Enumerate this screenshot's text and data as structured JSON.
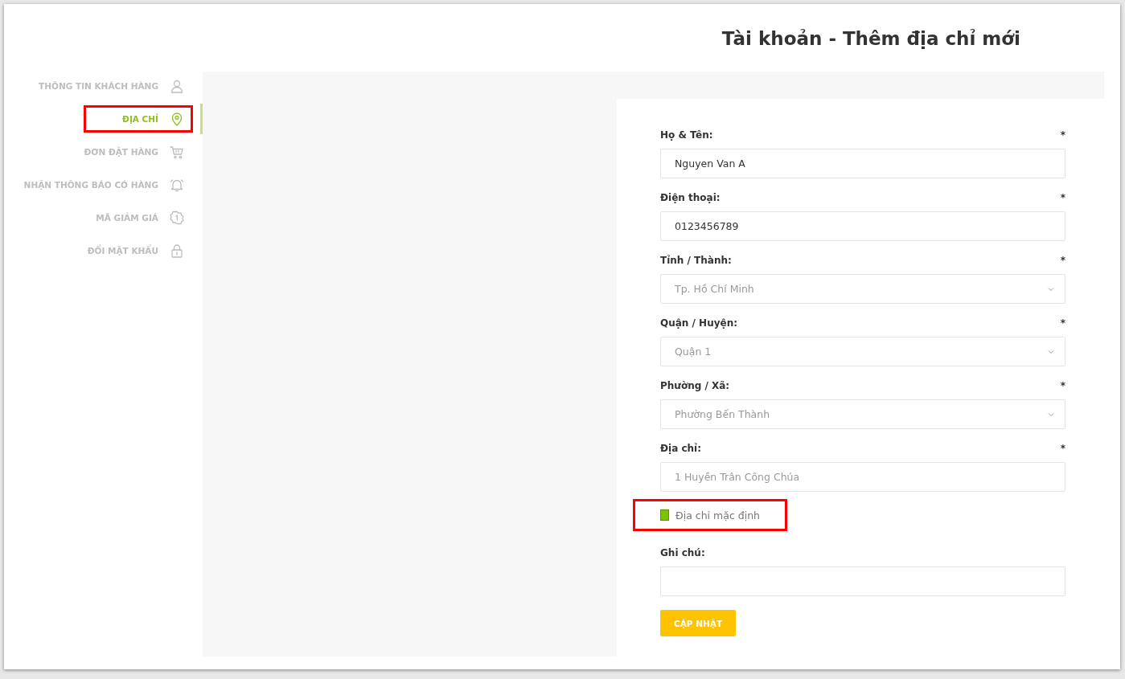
{
  "page_title": "Tài khoản - Thêm địa chỉ mới",
  "sidebar": {
    "items": [
      {
        "label": "THÔNG TIN KHÁCH HÀNG",
        "selected": false,
        "highlighted": false
      },
      {
        "label": "ĐỊA CHỈ",
        "selected": true,
        "highlighted": true
      },
      {
        "label": "ĐƠN ĐẶT HÀNG",
        "selected": false,
        "highlighted": false
      },
      {
        "label": "NHẬN THÔNG BÁO CÓ HÀNG",
        "selected": false,
        "highlighted": false
      },
      {
        "label": "MÃ GIẢM GIÁ",
        "selected": false,
        "highlighted": false
      },
      {
        "label": "ĐỔI MẬT KHẨU",
        "selected": false,
        "highlighted": false
      }
    ]
  },
  "form": {
    "fields": [
      {
        "kind": "text",
        "label": "Họ & Tên:",
        "required": "*",
        "value": "Nguyen Van A"
      },
      {
        "kind": "text",
        "label": "Điện thoại:",
        "required": "*",
        "value": "0123456789"
      },
      {
        "kind": "select",
        "label": "Tỉnh / Thành:",
        "required": "*",
        "value": "Tp. Hồ Chí Minh"
      },
      {
        "kind": "select",
        "label": "Quận / Huyện:",
        "required": "*",
        "value": "Quận 1"
      },
      {
        "kind": "select",
        "label": "Phường / Xã:",
        "required": "*",
        "value": "Phường Bến Thành"
      },
      {
        "kind": "text",
        "label": "Địa chỉ:",
        "required": "*",
        "placeholder": "1 Huyền Trân Công Chúa"
      },
      {
        "kind": "checkbox",
        "label": "Địa chỉ mặc định",
        "checked": true,
        "highlighted": true
      },
      {
        "kind": "text",
        "label": "Ghi chú:"
      }
    ],
    "submit": "CẬP NHẬT"
  }
}
